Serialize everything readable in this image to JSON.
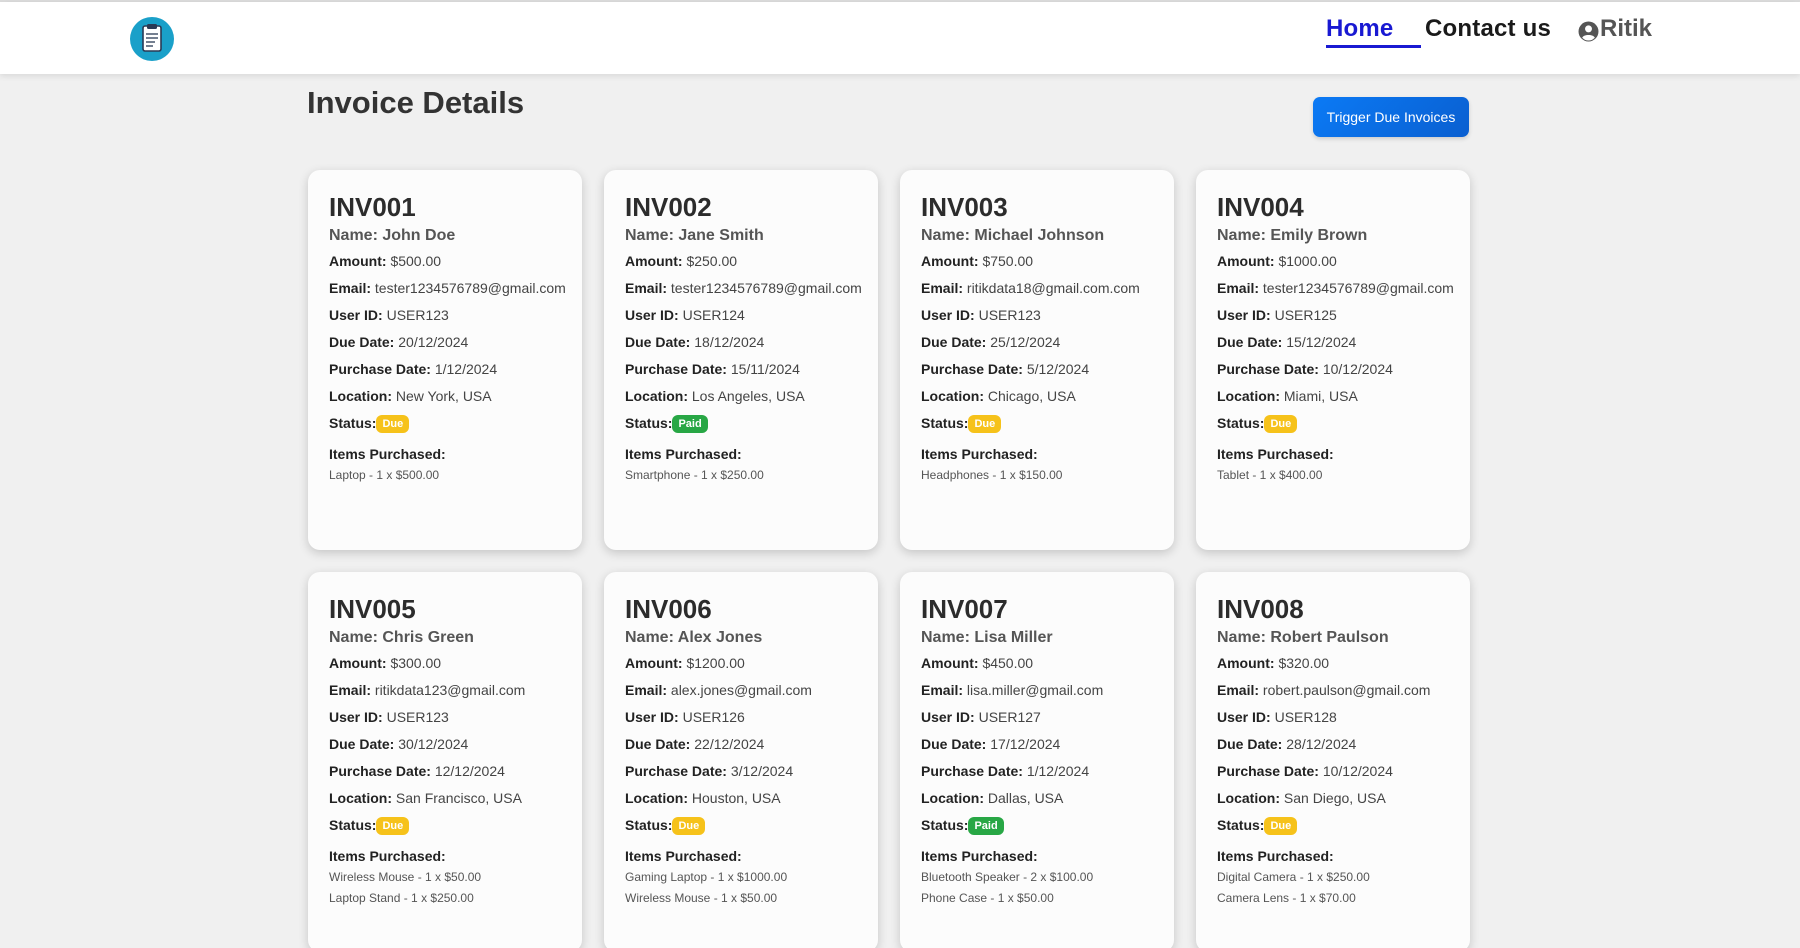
{
  "nav": {
    "home": "Home",
    "contact": "Contact us",
    "user": "Ritik"
  },
  "page": {
    "title": "Invoice Details",
    "trigger_button": "Trigger Due Invoices"
  },
  "labels": {
    "name": "Name:",
    "amount": "Amount:",
    "email": "Email:",
    "user_id": "User ID:",
    "due_date": "Due Date:",
    "purchase_date": "Purchase Date:",
    "location": "Location:",
    "status": "Status:",
    "items_purchased": "Items Purchased:"
  },
  "colors": {
    "home_link": "#1919d2",
    "button": "#0b7af5",
    "due": "#f6c21a",
    "paid": "#28a745"
  },
  "invoices": [
    {
      "id": "INV001",
      "name": "John Doe",
      "amount": "$500.00",
      "email": "tester1234576789@gmail.com",
      "user_id": "USER123",
      "due_date": "20/12/2024",
      "purchase_date": "1/12/2024",
      "location": "New York, USA",
      "status": "Due",
      "items": [
        "Laptop - 1 x $500.00"
      ]
    },
    {
      "id": "INV002",
      "name": "Jane Smith",
      "amount": "$250.00",
      "email": "tester1234576789@gmail.com",
      "user_id": "USER124",
      "due_date": "18/12/2024",
      "purchase_date": "15/11/2024",
      "location": "Los Angeles, USA",
      "status": "Paid",
      "items": [
        "Smartphone - 1 x $250.00"
      ]
    },
    {
      "id": "INV003",
      "name": "Michael Johnson",
      "amount": "$750.00",
      "email": "ritikdata18@gmail.com.com",
      "user_id": "USER123",
      "due_date": "25/12/2024",
      "purchase_date": "5/12/2024",
      "location": "Chicago, USA",
      "status": "Due",
      "items": [
        "Headphones - 1 x $150.00"
      ]
    },
    {
      "id": "INV004",
      "name": "Emily Brown",
      "amount": "$1000.00",
      "email": "tester1234576789@gmail.com",
      "user_id": "USER125",
      "due_date": "15/12/2024",
      "purchase_date": "10/12/2024",
      "location": "Miami, USA",
      "status": "Due",
      "items": [
        "Tablet - 1 x $400.00"
      ]
    },
    {
      "id": "INV005",
      "name": "Chris Green",
      "amount": "$300.00",
      "email": "ritikdata123@gmail.com",
      "user_id": "USER123",
      "due_date": "30/12/2024",
      "purchase_date": "12/12/2024",
      "location": "San Francisco, USA",
      "status": "Due",
      "items": [
        "Wireless Mouse - 1 x $50.00",
        "Laptop Stand - 1 x $250.00"
      ]
    },
    {
      "id": "INV006",
      "name": "Alex Jones",
      "amount": "$1200.00",
      "email": "alex.jones@gmail.com",
      "user_id": "USER126",
      "due_date": "22/12/2024",
      "purchase_date": "3/12/2024",
      "location": "Houston, USA",
      "status": "Due",
      "items": [
        "Gaming Laptop - 1 x $1000.00",
        "Wireless Mouse - 1 x $50.00"
      ]
    },
    {
      "id": "INV007",
      "name": "Lisa Miller",
      "amount": "$450.00",
      "email": "lisa.miller@gmail.com",
      "user_id": "USER127",
      "due_date": "17/12/2024",
      "purchase_date": "1/12/2024",
      "location": "Dallas, USA",
      "status": "Paid",
      "items": [
        "Bluetooth Speaker - 2 x $100.00",
        "Phone Case - 1 x $50.00"
      ]
    },
    {
      "id": "INV008",
      "name": "Robert Paulson",
      "amount": "$320.00",
      "email": "robert.paulson@gmail.com",
      "user_id": "USER128",
      "due_date": "28/12/2024",
      "purchase_date": "10/12/2024",
      "location": "San Diego, USA",
      "status": "Due",
      "items": [
        "Digital Camera - 1 x $250.00",
        "Camera Lens - 1 x $70.00"
      ]
    }
  ]
}
